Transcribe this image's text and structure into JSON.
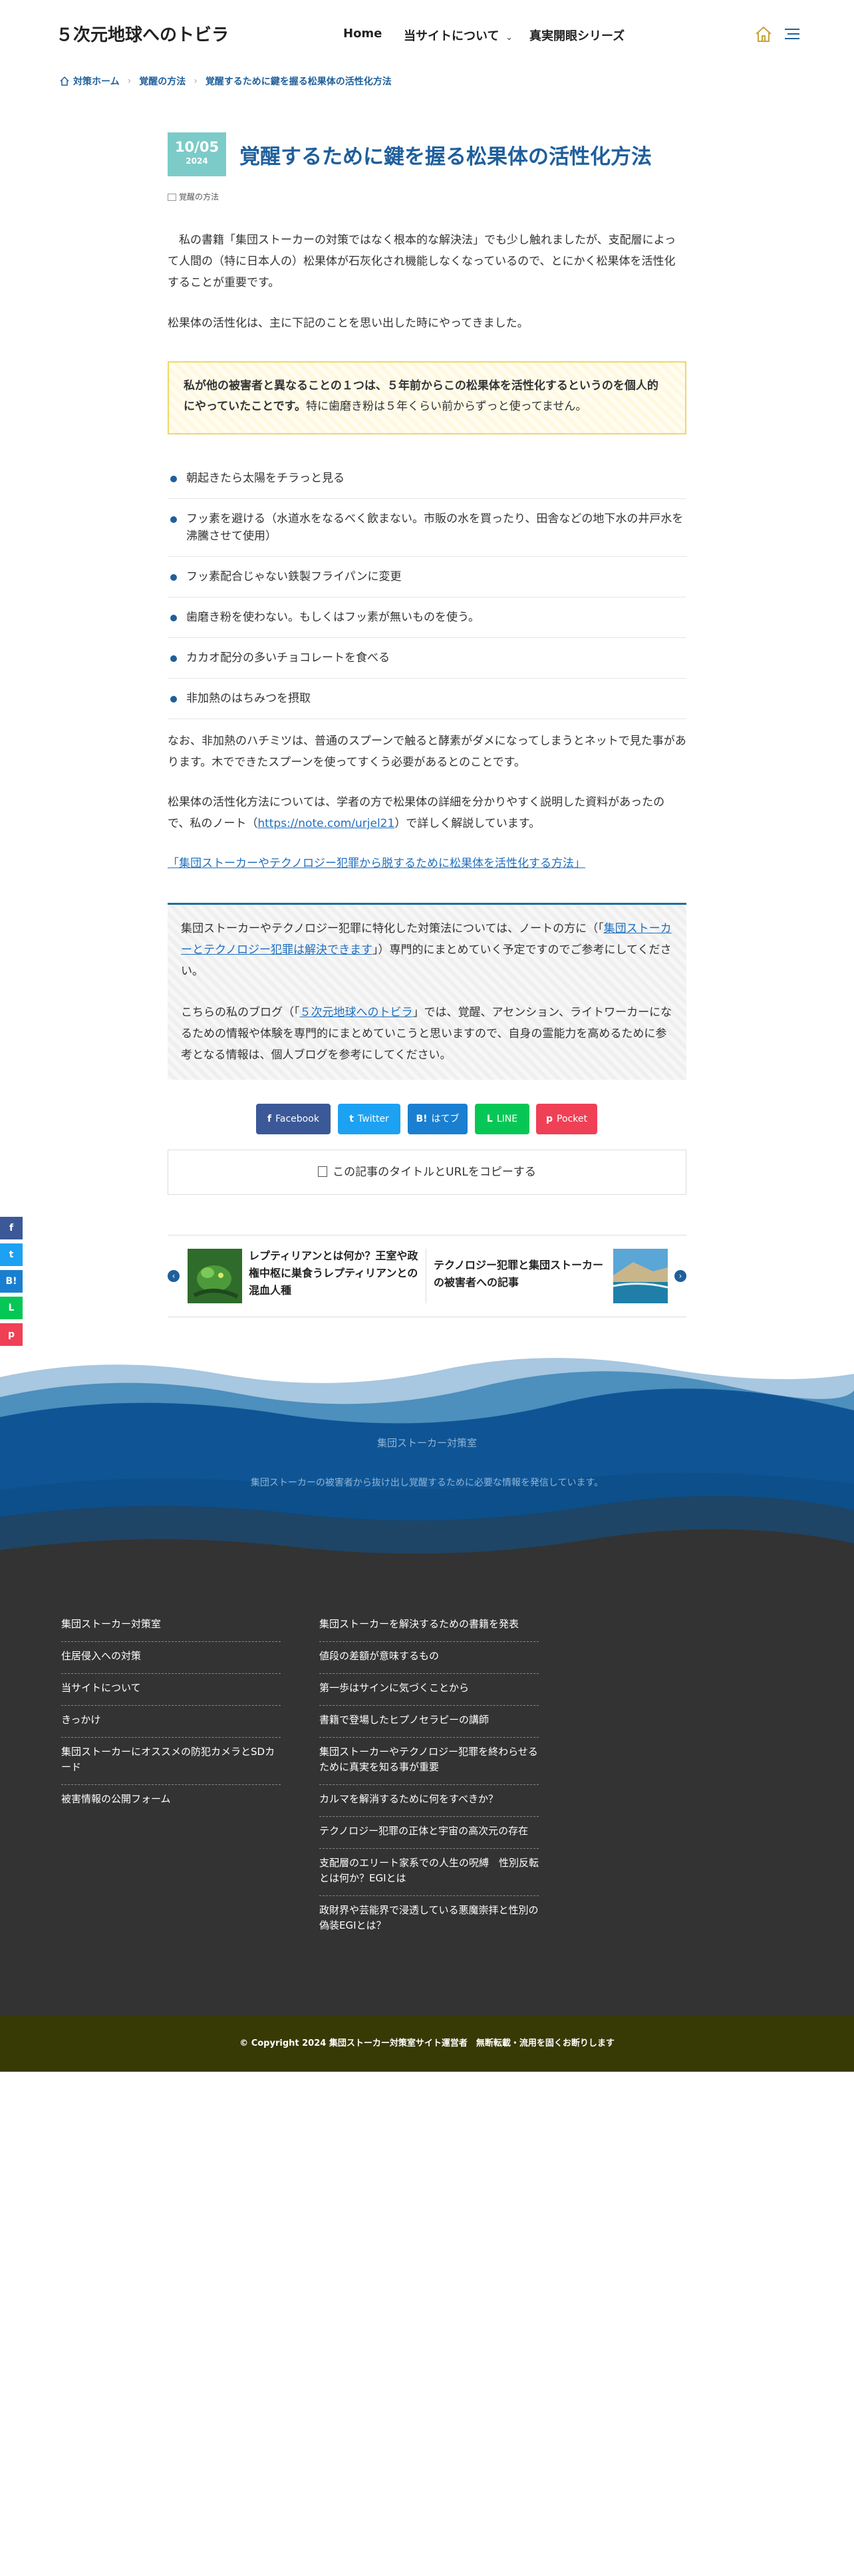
{
  "header": {
    "site_title": "５次元地球へのトビラ",
    "nav": [
      "Home",
      "当サイトについて",
      "真実開眼シリーズ"
    ]
  },
  "breadcrumb": [
    "対策ホーム",
    "覚醒の方法",
    "覚醒するために鍵を握る松果体の活性化方法"
  ],
  "article": {
    "date_md": "10/05",
    "date_year": "2024",
    "title": "覚醒するために鍵を握る松果体の活性化方法",
    "category": "覚醒の方法",
    "intro": "　私の書籍「集団ストーカーの対策ではなく根本的な解決法」でも少し触れましたが、支配層によって人間の（特に日本人の）松果体が石灰化され機能しなくなっているので、とにかく松果体を活性化することが重要です。",
    "p2": "松果体の活性化は、主に下記のことを思い出した時にやってきました。",
    "note_bold": "私が他の被害者と異なることの１つは、５年前からこの松果体を活性化するというのを個人的にやっていたことです。",
    "note_normal": "特に歯磨き粉は５年くらい前からずっと使ってません。",
    "list": [
      "朝起きたら太陽をチラっと見る",
      "フッ素を避ける（水道水をなるべく飲まない。市販の水を買ったり、田舎などの地下水の井戸水を沸騰させて使用）",
      "フッ素配合じゃない鉄製フライパンに変更",
      "歯磨き粉を使わない。もしくはフッ素が無いものを使う。",
      "カカオ配分の多いチョコレートを食べる",
      "非加熱のはちみつを摂取"
    ],
    "p3": "なお、非加熱のハチミツは、普通のスプーンで触ると酵素がダメになってしまうとネットで見た事があります。木でできたスプーンを使ってすくう必要があるとのことです。",
    "p4_before": "松果体の活性化方法については、学者の方で松果体の詳細を分かりやすく説明した資料があったので、私のノート（",
    "p4_link": "https://note.com/urjel21",
    "p4_after": "）で詳しく解説しています。",
    "related_link": "「集団ストーカーやテクノロジー犯罪から脱するために松果体を活性化する方法」"
  },
  "infobox": {
    "p1_before": "集団ストーカーやテクノロジー犯罪に特化した対策法については、ノートの方に（「",
    "p1_link": "集団ストーカーとテクノロジー犯罪は解決できます",
    "p1_after": "」）専門的にまとめていく予定ですのでご参考にしてください。",
    "p2_before": "こちらの私のブログ（「",
    "p2_link": "５次元地球へのトビラ",
    "p2_after": "」では、覚醒、アセンション、ライトワーカーになるための情報や体験を専門的にまとめていこうと思いますので、自身の霊能力を高めるために参考となる情報は、個人ブログを参考にしてください。"
  },
  "share": {
    "buttons": [
      {
        "label": "Facebook",
        "icon": "f",
        "color": "#3b5998"
      },
      {
        "label": "Twitter",
        "icon": "t",
        "color": "#1da1f2"
      },
      {
        "label": "はてブ",
        "icon": "B!",
        "color": "#1a7fd0"
      },
      {
        "label": "LINE",
        "icon": "L",
        "color": "#06c755"
      },
      {
        "label": "Pocket",
        "icon": "p",
        "color": "#ef4056"
      }
    ],
    "copy_label": "この記事のタイトルとURLをコピーする",
    "sidebar": [
      {
        "icon": "f",
        "color": "#3b5998"
      },
      {
        "icon": "t",
        "color": "#1da1f2"
      },
      {
        "icon": "B!",
        "color": "#1a7fd0"
      },
      {
        "icon": "L",
        "color": "#06c755"
      },
      {
        "icon": "p",
        "color": "#ef4056"
      }
    ]
  },
  "prev_next": {
    "prev_title": "レプティリアンとは何か？王室や政権中枢に巣食うレプティリアンとの混血人種",
    "next_title": "テクノロジー犯罪と集団ストーカーの被害者への記事"
  },
  "footer": {
    "title": "集団ストーカー対策室",
    "tagline": "集団ストーカーの被害者から抜け出し覚醒するために必要な情報を発信しています。",
    "col1": [
      "集団ストーカー対策室",
      "住居侵入への対策",
      "当サイトについて",
      "きっかけ",
      "集団ストーカーにオススメの防犯カメラとSDカード",
      "被害情報の公開フォーム"
    ],
    "col2": [
      "集団ストーカーを解決するための書籍を発表",
      "値段の差額が意味するもの",
      "第一歩はサインに気づくことから",
      "書籍で登場したヒプノセラピーの講師",
      "集団ストーカーやテクノロジー犯罪を終わらせるために真実を知る事が重要",
      "カルマを解消するために何をすべきか？",
      "テクノロジー犯罪の正体と宇宙の高次元の存在",
      "支配層のエリート家系での人生の呪縛　性別反転とは何か？EGIとは",
      "政財界や芸能界で浸透している悪魔崇拝と性別の偽装EGIとは？"
    ],
    "copyright": "© Copyright 2024 集団ストーカー対策室サイト運営者　無断転載・流用を固くお断りします"
  },
  "colors": {
    "accent": "#1f5f9b",
    "date_box": "#7ccbc8",
    "note_border": "#f0d66b",
    "footer_dark": "#333333",
    "copyright_bar": "#383a06"
  }
}
